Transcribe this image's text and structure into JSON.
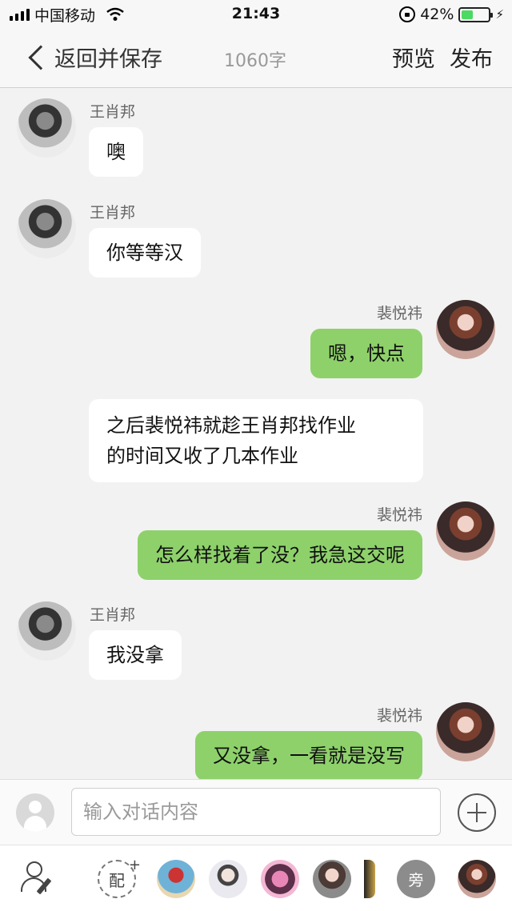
{
  "status_bar": {
    "carrier": "中国移动",
    "time": "21:43",
    "battery": "42%",
    "battery_level": 0.42,
    "icons": [
      "signal-icon",
      "wifi-icon",
      "rotation-lock-icon",
      "battery-icon",
      "charging-bolt-icon"
    ]
  },
  "nav": {
    "back_label": "返回并保存",
    "word_count": "1060字",
    "preview": "预览",
    "publish": "发布"
  },
  "messages": [
    {
      "side": "left",
      "name": "王肖邦",
      "text": "噢"
    },
    {
      "side": "left",
      "name": "王肖邦",
      "text": "你等等汉"
    },
    {
      "side": "right",
      "name": "裴悦祎",
      "text": "嗯，快点"
    },
    {
      "side": "narration",
      "line1": "之后裴悦祎就趁王肖邦找作业",
      "line2": "的时间又收了几本作业"
    },
    {
      "side": "right",
      "name": "裴悦祎",
      "text": "怎么样找着了没？我急这交呢"
    },
    {
      "side": "left",
      "name": "王肖邦",
      "text": "我没拿"
    },
    {
      "side": "right",
      "name": "裴悦祎",
      "text": "又没拿，一看就是没写"
    }
  ],
  "input": {
    "placeholder": "输入对话内容"
  },
  "toolbar": {
    "match_label": "配",
    "match_plus": "+",
    "narrator_label": "旁"
  },
  "colors": {
    "chat_background": "#f2f2f2",
    "sent_bubble": "#8ed16b",
    "received_bubble": "#ffffff"
  }
}
